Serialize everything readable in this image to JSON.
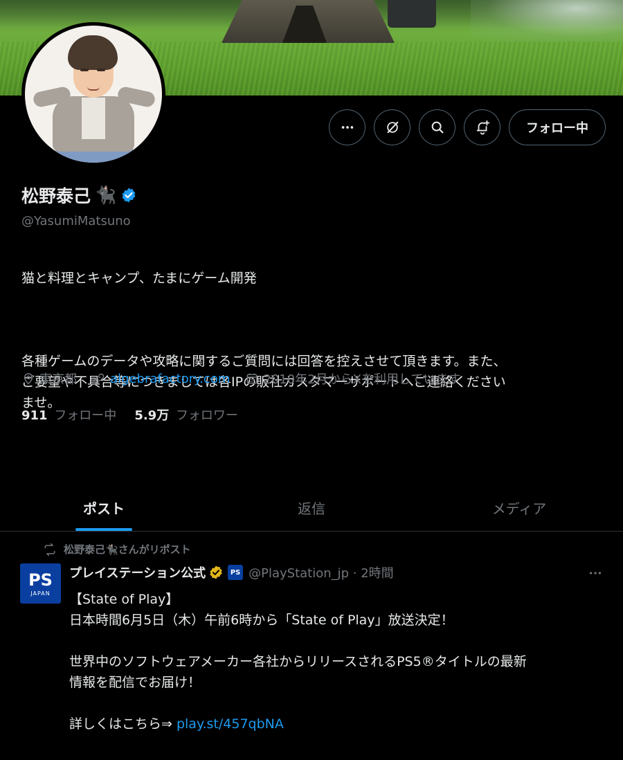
{
  "profile": {
    "name": "松野泰己",
    "name_emoji": "🐈‍⬛",
    "handle": "@YasumiMatsuno",
    "bio_line1": "猫と料理とキャンプ、たまにゲーム開発",
    "bio_line2": "各種ゲームのデータや攻略に関するご質問には回答を控えさせて頂きます。また、\nご要望や不具合等につきましては各IPの販社カスタマーサポートへご連絡ください\nませ。",
    "location": "東京都",
    "website": "algebrafactory.com",
    "joined": "2010年2月からXを利用しています",
    "following_count": "911",
    "following_label": "フォロー中",
    "followers_count": "5.9万",
    "followers_label": "フォロワー"
  },
  "actions": {
    "follow_label": "フォロー中",
    "icons": [
      "more-icon",
      "grok-icon",
      "search-icon",
      "notification-bell-icon"
    ]
  },
  "tabs": [
    {
      "label": "ポスト",
      "active": true
    },
    {
      "label": "返信",
      "active": false
    },
    {
      "label": "メディア",
      "active": false
    }
  ],
  "post": {
    "repost_by": "松野泰己🐈‍⬛さんがリポスト",
    "avatar_text": "PS",
    "avatar_sub": "JAPAN",
    "author": "プレイステーション公式",
    "affiliate_badge": "PS",
    "handle_time": "@PlayStation_jp · 2時間",
    "line1": "【State of Play】",
    "line2": "日本時間6月5日（木）午前6時から「State of Play」放送決定！",
    "line3": "世界中のソフトウェアメーカー各社からリリースされるPS5®タイトルの最新",
    "line4": "情報を配信でお届け！",
    "line5_prefix": "詳しくはこちら⇒ ",
    "line5_link": "play.st/457qbNA"
  },
  "colors": {
    "accent": "#1d9bf0",
    "muted": "#71767b",
    "border": "#2f3336",
    "gold": "#e2b719"
  }
}
